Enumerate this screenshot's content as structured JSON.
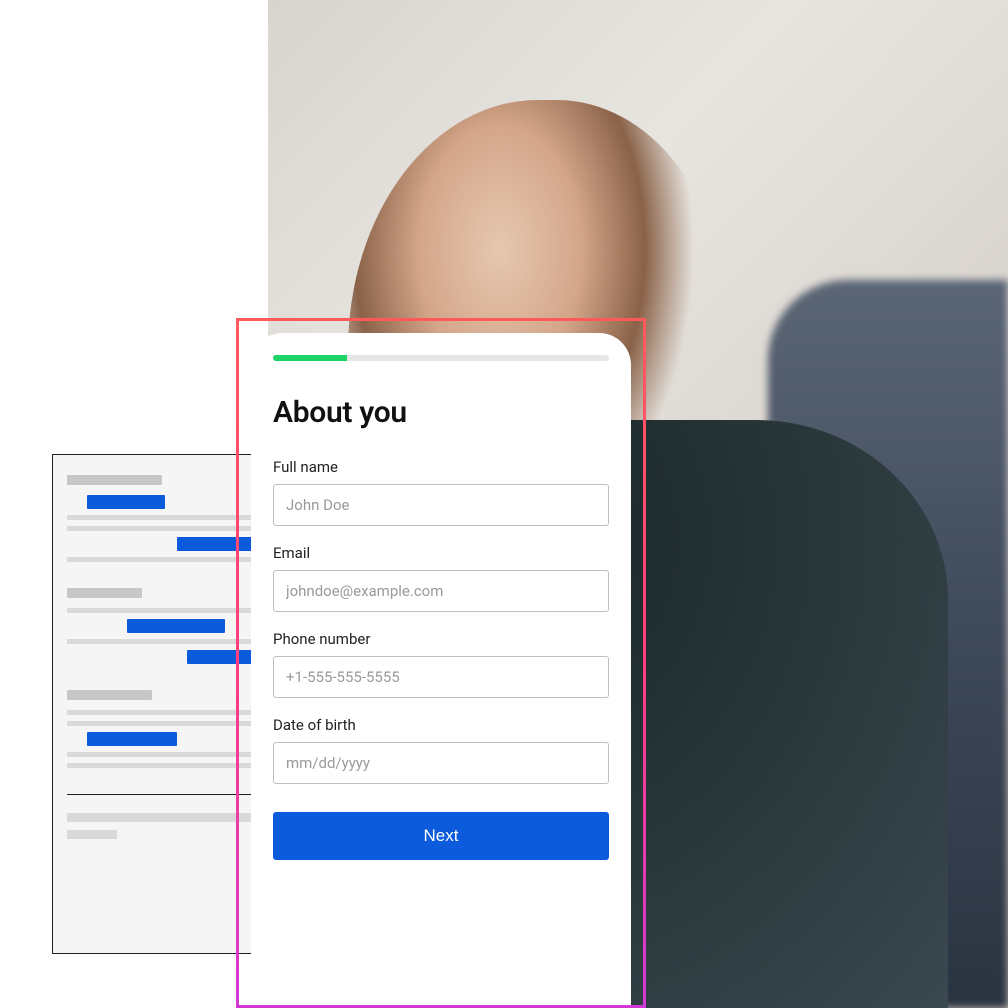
{
  "background": {
    "description": "Smiling woman in dark green sweater, office environment, blurred foreground shoulder"
  },
  "gantt": {
    "description": "Abstract document/timeline card with grey placeholder lines and blue bars"
  },
  "form": {
    "progress_percent": 22,
    "title": "About you",
    "fields": {
      "full_name": {
        "label": "Full name",
        "placeholder": "John Doe",
        "value": ""
      },
      "email": {
        "label": "Email",
        "placeholder": "johndoe@example.com",
        "value": ""
      },
      "phone": {
        "label": "Phone number",
        "placeholder": "+1-555-555-5555",
        "value": ""
      },
      "dob": {
        "label": "Date of birth",
        "placeholder": "mm/dd/yyyy",
        "value": ""
      }
    },
    "next_button": "Next"
  },
  "colors": {
    "primary_blue": "#0d5bdd",
    "progress_green": "#1dd368",
    "frame_gradient_start": "#ff5a5a",
    "frame_gradient_end": "#d138d6"
  }
}
